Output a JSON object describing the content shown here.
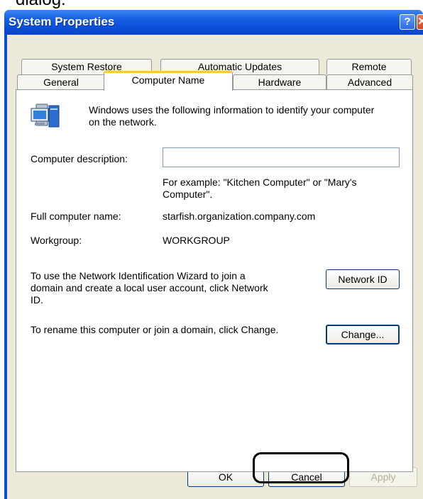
{
  "caption_fragment": "dialog.",
  "window": {
    "title": "System Properties",
    "help_glyph": "?",
    "close_glyph": "✕"
  },
  "tabs": {
    "row1": [
      "System Restore",
      "Automatic Updates",
      "Remote"
    ],
    "row2": [
      "General",
      "Computer Name",
      "Hardware",
      "Advanced"
    ],
    "active": "Computer Name"
  },
  "computer_name_panel": {
    "intro_line1": "Windows uses the following information to identify your computer",
    "intro_line2": "on the network.",
    "description_label": "Computer description:",
    "description_value": "",
    "example_line1": "For example: \"Kitchen Computer\" or \"Mary's",
    "example_line2": "Computer\".",
    "full_name_label": "Full computer name:",
    "full_name_value": "starfish.organization.company.com",
    "workgroup_label": "Workgroup:",
    "workgroup_value": "WORKGROUP",
    "network_id_text_line1": "To use the Network Identification Wizard to join a",
    "network_id_text_line2": "domain and create a local user account, click Network",
    "network_id_text_line3": "ID.",
    "network_id_button": "Network ID",
    "rename_text": "To rename this computer or join a domain, click Change.",
    "change_button": "Change..."
  },
  "footer": {
    "ok_button": "OK",
    "cancel_button": "Cancel",
    "apply_button": "Apply"
  },
  "icons": {
    "computer": "computer-icon"
  },
  "colors": {
    "titlebar": "#0a4fd8",
    "client": "#ece9d8",
    "active_tab_accent": "#ffc83c"
  }
}
